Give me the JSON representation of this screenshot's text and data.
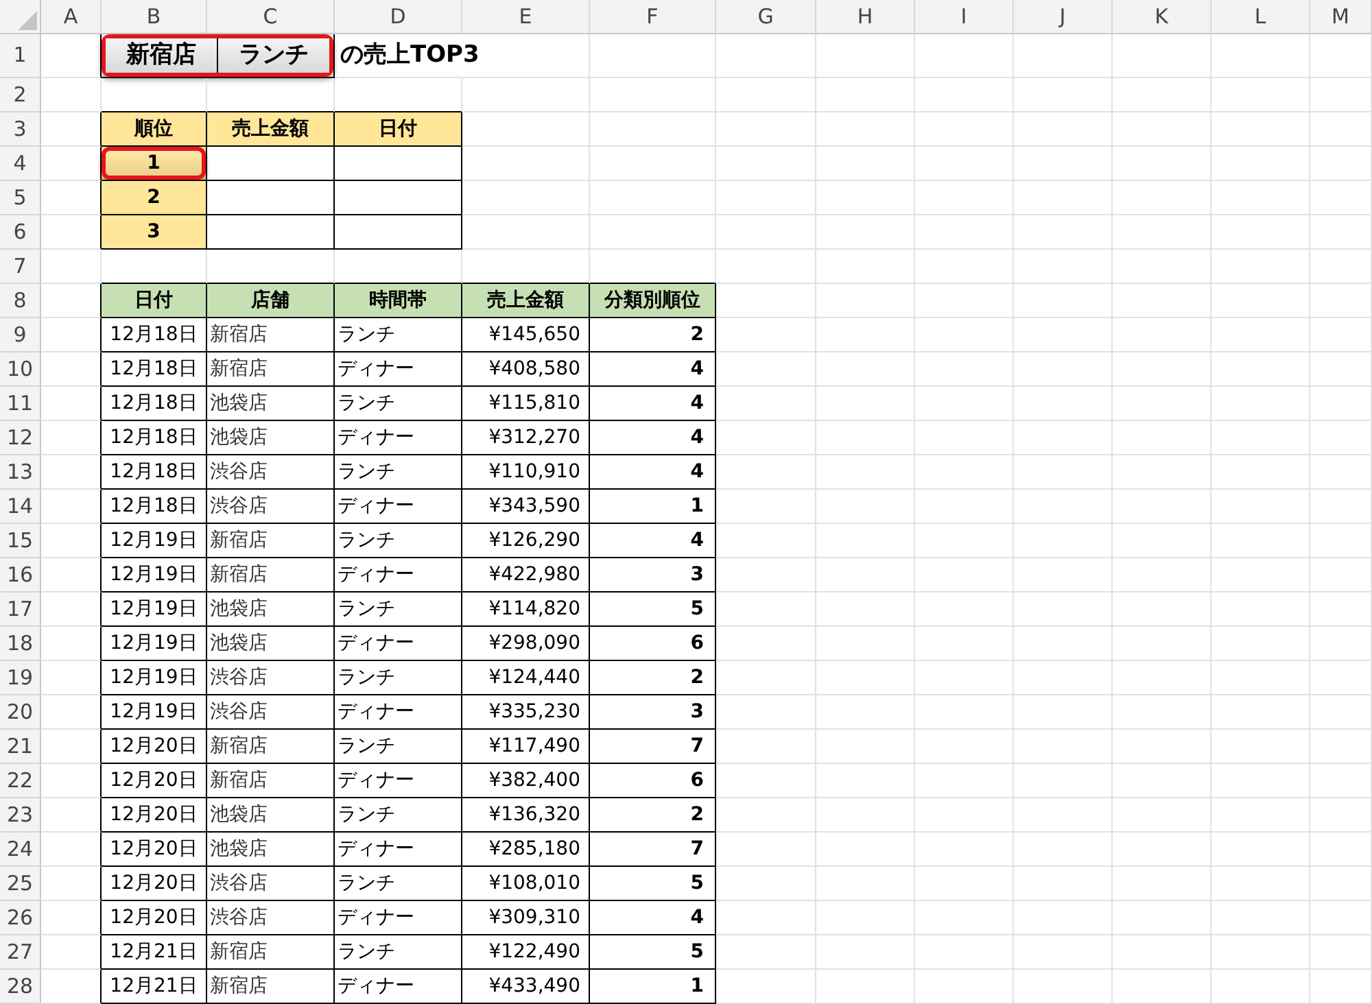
{
  "column_headers": [
    "A",
    "B",
    "C",
    "D",
    "E",
    "F",
    "G",
    "H",
    "I",
    "J",
    "K",
    "L",
    "M"
  ],
  "row_headers": [
    "1",
    "2",
    "3",
    "4",
    "5",
    "6",
    "7",
    "8",
    "9",
    "10",
    "11",
    "12",
    "13",
    "14",
    "15",
    "16",
    "17",
    "18",
    "19",
    "20",
    "21",
    "22",
    "23",
    "24",
    "25",
    "26",
    "27",
    "28"
  ],
  "title": {
    "highlighted": true,
    "cells": [
      "新宿店",
      "ランチ"
    ],
    "suffix": "の売上TOP3"
  },
  "top3": {
    "columns": [
      "順位",
      "売上金額",
      "日付"
    ],
    "rows": [
      {
        "rank": "1",
        "highlighted": true
      },
      {
        "rank": "2",
        "highlighted": false
      },
      {
        "rank": "3",
        "highlighted": false
      }
    ]
  },
  "sales": {
    "columns": [
      "日付",
      "店舗",
      "時間帯",
      "売上金額",
      "分類別順位"
    ],
    "rows": [
      {
        "date": "12月18日",
        "store": "新宿店",
        "time": "ランチ",
        "amount": "¥145,650",
        "rank": "2"
      },
      {
        "date": "12月18日",
        "store": "新宿店",
        "time": "ディナー",
        "amount": "¥408,580",
        "rank": "4"
      },
      {
        "date": "12月18日",
        "store": "池袋店",
        "time": "ランチ",
        "amount": "¥115,810",
        "rank": "4"
      },
      {
        "date": "12月18日",
        "store": "池袋店",
        "time": "ディナー",
        "amount": "¥312,270",
        "rank": "4"
      },
      {
        "date": "12月18日",
        "store": "渋谷店",
        "time": "ランチ",
        "amount": "¥110,910",
        "rank": "4"
      },
      {
        "date": "12月18日",
        "store": "渋谷店",
        "time": "ディナー",
        "amount": "¥343,590",
        "rank": "1"
      },
      {
        "date": "12月19日",
        "store": "新宿店",
        "time": "ランチ",
        "amount": "¥126,290",
        "rank": "4"
      },
      {
        "date": "12月19日",
        "store": "新宿店",
        "time": "ディナー",
        "amount": "¥422,980",
        "rank": "3"
      },
      {
        "date": "12月19日",
        "store": "池袋店",
        "time": "ランチ",
        "amount": "¥114,820",
        "rank": "5"
      },
      {
        "date": "12月19日",
        "store": "池袋店",
        "time": "ディナー",
        "amount": "¥298,090",
        "rank": "6"
      },
      {
        "date": "12月19日",
        "store": "渋谷店",
        "time": "ランチ",
        "amount": "¥124,440",
        "rank": "2"
      },
      {
        "date": "12月19日",
        "store": "渋谷店",
        "time": "ディナー",
        "amount": "¥335,230",
        "rank": "3"
      },
      {
        "date": "12月20日",
        "store": "新宿店",
        "time": "ランチ",
        "amount": "¥117,490",
        "rank": "7"
      },
      {
        "date": "12月20日",
        "store": "新宿店",
        "time": "ディナー",
        "amount": "¥382,400",
        "rank": "6"
      },
      {
        "date": "12月20日",
        "store": "池袋店",
        "time": "ランチ",
        "amount": "¥136,320",
        "rank": "2"
      },
      {
        "date": "12月20日",
        "store": "池袋店",
        "time": "ディナー",
        "amount": "¥285,180",
        "rank": "7"
      },
      {
        "date": "12月20日",
        "store": "渋谷店",
        "time": "ランチ",
        "amount": "¥108,010",
        "rank": "5"
      },
      {
        "date": "12月20日",
        "store": "渋谷店",
        "time": "ディナー",
        "amount": "¥309,310",
        "rank": "4"
      },
      {
        "date": "12月21日",
        "store": "新宿店",
        "time": "ランチ",
        "amount": "¥122,490",
        "rank": "5"
      },
      {
        "date": "12月21日",
        "store": "新宿店",
        "time": "ディナー",
        "amount": "¥433,490",
        "rank": "1"
      }
    ]
  }
}
